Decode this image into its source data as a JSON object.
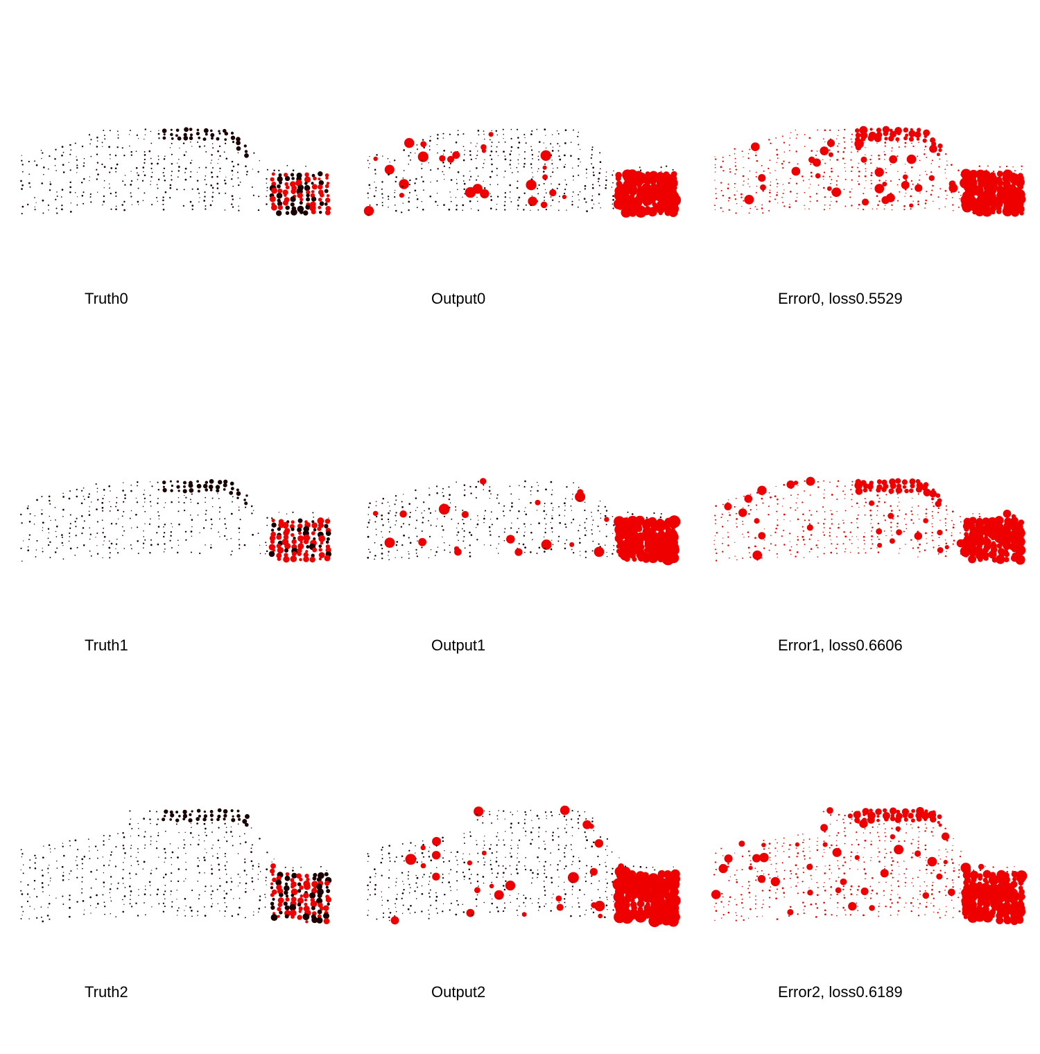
{
  "colors": {
    "background": "#ffffff",
    "dark_point": "#1a0000",
    "error_point": "#ee0000"
  },
  "rows": [
    {
      "truth": "Truth0",
      "output": "Output0",
      "error": "Error0, loss0.5529"
    },
    {
      "truth": "Truth1",
      "output": "Output1",
      "error": "Error1, loss0.6606"
    },
    {
      "truth": "Truth2",
      "output": "Output2",
      "error": "Error2, loss0.6189"
    }
  ]
}
